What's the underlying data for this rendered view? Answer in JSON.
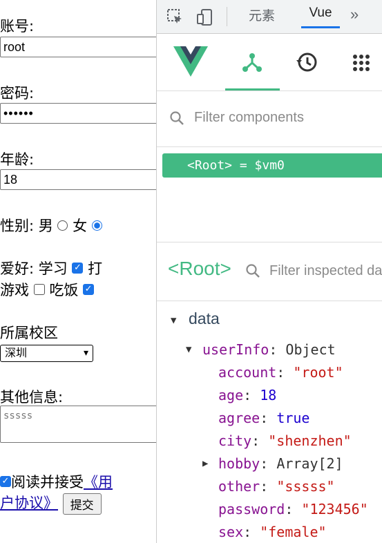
{
  "form": {
    "account_label": "账号:",
    "account_value": "root",
    "password_label": "密码:",
    "password_value": "••••••",
    "age_label": "年龄:",
    "age_value": "18",
    "gender_label": "性别:",
    "gender_male": "男",
    "gender_female": "女",
    "hobby_label": "爱好:",
    "hobby_study": "学习",
    "hobby_play": "打",
    "hobby_game": "游戏",
    "hobby_eat": "吃饭",
    "campus_label": "所属校区",
    "campus_value": "深圳",
    "other_label": "其他信息:",
    "other_value": "sssss",
    "agree_text": "阅读并接受",
    "agree_link_1": "《用",
    "agree_link_2": "户协议》",
    "submit_label": "提交"
  },
  "devtools": {
    "tabs": [
      "元素",
      "Vue",
      "»"
    ],
    "filter_components_placeholder": "Filter components",
    "root_label": "<Root> = $vm0",
    "inspect_title": "<Root>",
    "filter_inspected_placeholder": "Filter inspected da",
    "data_section": "data"
  },
  "state_tree": {
    "userInfo_key": "userInfo",
    "userInfo_type": "Object",
    "fields": [
      {
        "key": "account",
        "value": "\"root\"",
        "kind": "string"
      },
      {
        "key": "age",
        "value": "18",
        "kind": "number"
      },
      {
        "key": "agree",
        "value": "true",
        "kind": "number"
      },
      {
        "key": "city",
        "value": "\"shenzhen\"",
        "kind": "string"
      },
      {
        "key": "hobby",
        "value": "Array[2]",
        "kind": "plain"
      },
      {
        "key": "other",
        "value": "\"sssss\"",
        "kind": "string"
      },
      {
        "key": "password",
        "value": "\"123456\"",
        "kind": "string"
      },
      {
        "key": "sex",
        "value": "\"female\"",
        "kind": "string"
      }
    ]
  },
  "colors": {
    "vue_green": "#42b983",
    "vue_dark": "#35495e",
    "accent_blue": "#1a73e8"
  }
}
